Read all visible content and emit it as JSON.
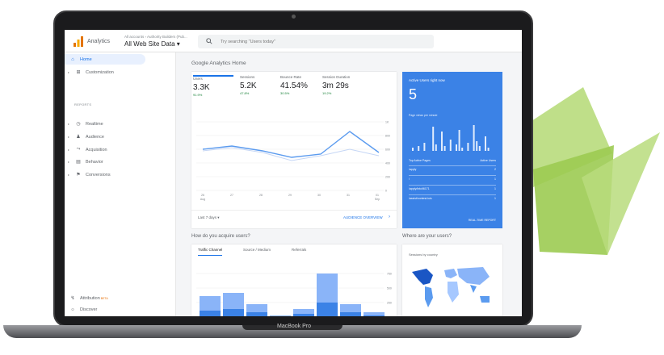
{
  "app": {
    "title": "Analytics",
    "breadcrumb": "All accounts › Authority Builders (Pub...",
    "view": "All Web Site Data ▾"
  },
  "search": {
    "placeholder": "Try searching \"Users today\""
  },
  "sidebar": {
    "section_label": "REPORTS",
    "items": [
      {
        "label": "Home"
      },
      {
        "label": "Customization"
      },
      {
        "label": "Realtime"
      },
      {
        "label": "Audience"
      },
      {
        "label": "Acquisition"
      },
      {
        "label": "Behavior"
      },
      {
        "label": "Conversions"
      },
      {
        "label": "Attribution",
        "badge": "BETA"
      },
      {
        "label": "Discover"
      }
    ]
  },
  "main": {
    "title": "Google Analytics Home",
    "metrics": [
      {
        "label": "Users",
        "value": "3.3K",
        "delta": "91.9%"
      },
      {
        "label": "Sessions",
        "value": "5.2K",
        "delta": "47.8%"
      },
      {
        "label": "Bounce Rate",
        "value": "41.54%",
        "delta": "30.5%"
      },
      {
        "label": "Session Duration",
        "value": "3m 29s",
        "delta": "19.2%"
      }
    ],
    "chart_y_labels": [
      "1K",
      "800",
      "600",
      "400",
      "200",
      "0"
    ],
    "chart_x_labels": [
      "26\nAug",
      "27",
      "28",
      "29",
      "30",
      "31",
      "01\nSep"
    ],
    "date_range": "Last 7 days ▾",
    "overview_link": "AUDIENCE OVERVIEW",
    "acquire_title": "How do you acquire users?",
    "acq_tabs": [
      "Traffic Channel",
      "Source / Medium",
      "Referrals"
    ],
    "acq_y_labels": [
      "750",
      "500",
      "250"
    ],
    "where_title": "Where are your users?",
    "sessions_country": "Sessions by country"
  },
  "realtime": {
    "title": "Active Users right now",
    "value": "5",
    "subtitle": "Page views per minute",
    "pages_header": "Top Active Pages",
    "users_header": "Active Users",
    "rows": [
      {
        "page": "/apply",
        "users": "2"
      },
      {
        "page": "/",
        "users": "1"
      },
      {
        "page": "/apply/into/t6171",
        "users": "1"
      },
      {
        "page": "/assist/contest-luis",
        "users": "1"
      }
    ],
    "report_link": "REAL-TIME REPORT"
  },
  "laptop": {
    "brand": "MacBook Pro"
  },
  "colors": {
    "accent": "#1a73e8",
    "realtime_bg": "#3b82e6",
    "green_deco": "#8dc63f"
  }
}
